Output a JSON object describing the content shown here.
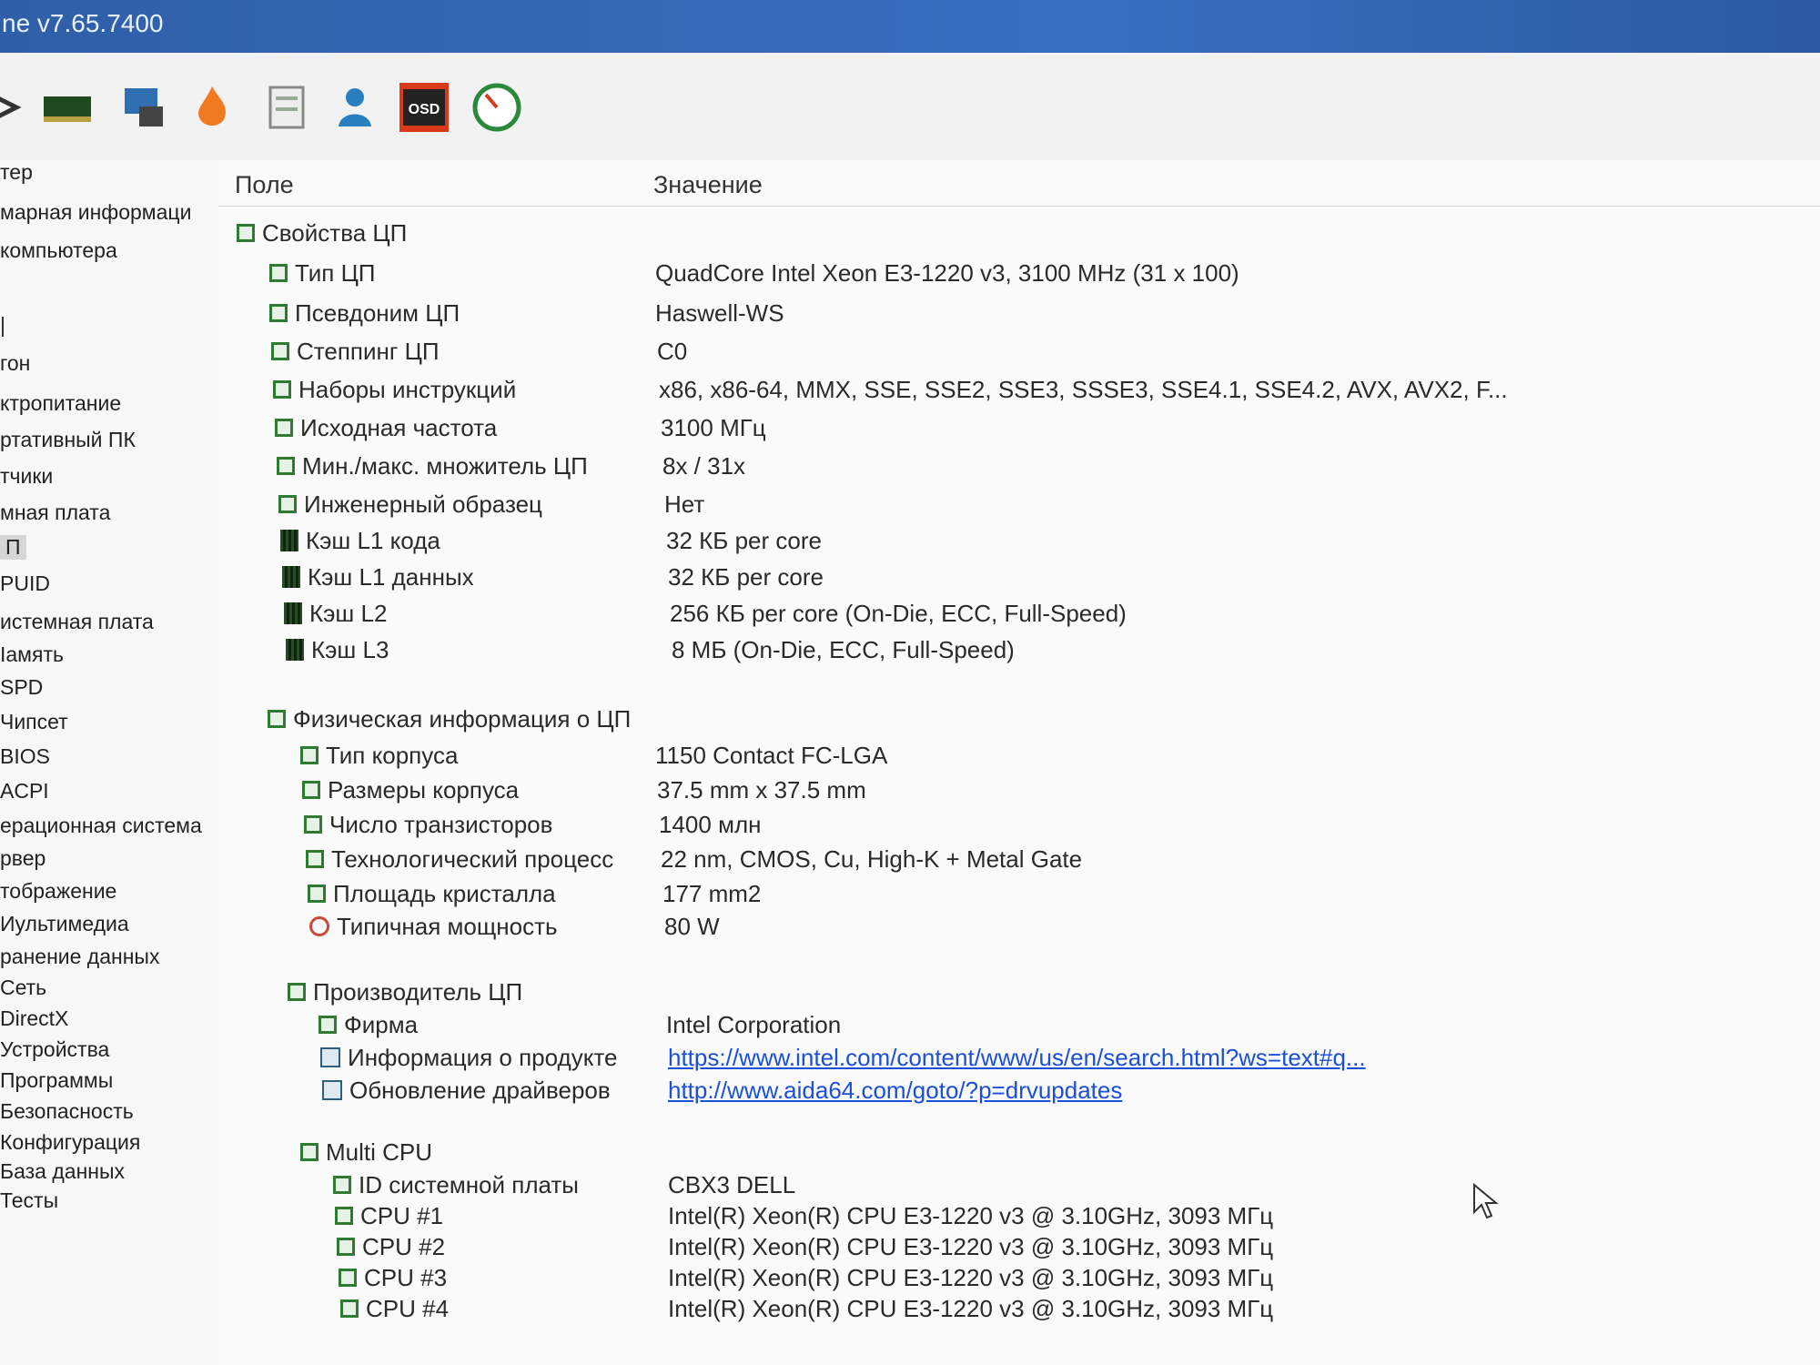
{
  "window": {
    "title": "ne v7.65.7400"
  },
  "toolbar": {
    "icons": [
      "arrow-icon",
      "memory-icon",
      "computer-icon",
      "flame-icon",
      "report-icon",
      "user-icon",
      "osd-icon",
      "gauge-icon"
    ],
    "osd_label": "OSD"
  },
  "sidebar": {
    "items": [
      {
        "label": "тер"
      },
      {
        "label": "марная информаци"
      },
      {
        "label": " компьютера"
      },
      {
        "label": "|"
      },
      {
        "label": "гон"
      },
      {
        "label": "ктропитание"
      },
      {
        "label": "ртативный ПК"
      },
      {
        "label": "тчики"
      },
      {
        "label": "мная плата"
      },
      {
        "label": "П"
      },
      {
        "label": "PUID"
      },
      {
        "label": "истемная плата"
      },
      {
        "label": "Іамять"
      },
      {
        "label": "SPD"
      },
      {
        "label": "Чипсет"
      },
      {
        "label": "BIOS"
      },
      {
        "label": "ACPI"
      },
      {
        "label": "ерационная система"
      },
      {
        "label": "рвер"
      },
      {
        "label": "тображение"
      },
      {
        "label": "Иультимедиа"
      },
      {
        "label": "ранение данных"
      },
      {
        "label": "Сеть"
      },
      {
        "label": "DirectX"
      },
      {
        "label": "Устройства"
      },
      {
        "label": "Программы"
      },
      {
        "label": "Безопасность"
      },
      {
        "label": "Конфигурация"
      },
      {
        "label": "База данных"
      },
      {
        "label": "Тесты"
      }
    ]
  },
  "table": {
    "col_field": "Поле",
    "col_value": "Значение",
    "rows": [
      {
        "field": "Свойства ЦП",
        "value": ""
      },
      {
        "field": "Тип ЦП",
        "value": "QuadCore Intel Xeon E3-1220 v3, 3100 MHz (31 x 100)"
      },
      {
        "field": "Псевдоним ЦП",
        "value": "Haswell-WS"
      },
      {
        "field": "Степпинг ЦП",
        "value": "C0"
      },
      {
        "field": "Наборы инструкций",
        "value": "x86, x86-64, MMX, SSE, SSE2, SSE3, SSSE3, SSE4.1, SSE4.2, AVX, AVX2, F..."
      },
      {
        "field": "Исходная частота",
        "value": "3100 МГц"
      },
      {
        "field": "Мин./макс. множитель ЦП",
        "value": "8x / 31x"
      },
      {
        "field": "Инженерный образец",
        "value": "Нет"
      },
      {
        "field": "Кэш L1 кода",
        "value": "32 КБ per core"
      },
      {
        "field": "Кэш L1 данных",
        "value": "32 КБ per core"
      },
      {
        "field": "Кэш L2",
        "value": "256 КБ per core  (On-Die, ECC, Full-Speed)"
      },
      {
        "field": "Кэш L3",
        "value": "8 МБ  (On-Die, ECC, Full-Speed)"
      },
      {
        "field": "Физическая информация о ЦП",
        "value": ""
      },
      {
        "field": "Тип корпуса",
        "value": "1150 Contact FC-LGA"
      },
      {
        "field": "Размеры корпуса",
        "value": "37.5 mm x 37.5 mm"
      },
      {
        "field": "Число транзисторов",
        "value": "1400 млн"
      },
      {
        "field": "Технологический процесс",
        "value": "22 nm, CMOS, Cu, High-K + Metal Gate"
      },
      {
        "field": "Площадь кристалла",
        "value": "177 mm2"
      },
      {
        "field": "Типичная мощность",
        "value": "80 W"
      },
      {
        "field": "Производитель ЦП",
        "value": ""
      },
      {
        "field": "Фирма",
        "value": "Intel Corporation"
      },
      {
        "field": "Информация о продукте",
        "value": "https://www.intel.com/content/www/us/en/search.html?ws=text#q..."
      },
      {
        "field": "Обновление драйверов",
        "value": "http://www.aida64.com/goto/?p=drvupdates"
      },
      {
        "field": "Multi CPU",
        "value": ""
      },
      {
        "field": "ID системной платы",
        "value": "CBX3 DELL"
      },
      {
        "field": "CPU #1",
        "value": "Intel(R) Xeon(R) CPU E3-1220 v3 @ 3.10GHz, 3093 МГц"
      },
      {
        "field": "CPU #2",
        "value": "Intel(R) Xeon(R) CPU E3-1220 v3 @ 3.10GHz, 3093 МГц"
      },
      {
        "field": "CPU #3",
        "value": "Intel(R) Xeon(R) CPU E3-1220 v3 @ 3.10GHz, 3093 МГц"
      },
      {
        "field": "CPU #4",
        "value": "Intel(R) Xeon(R) CPU E3-1220 v3 @ 3.10GHz, 3093 МГц"
      }
    ]
  }
}
